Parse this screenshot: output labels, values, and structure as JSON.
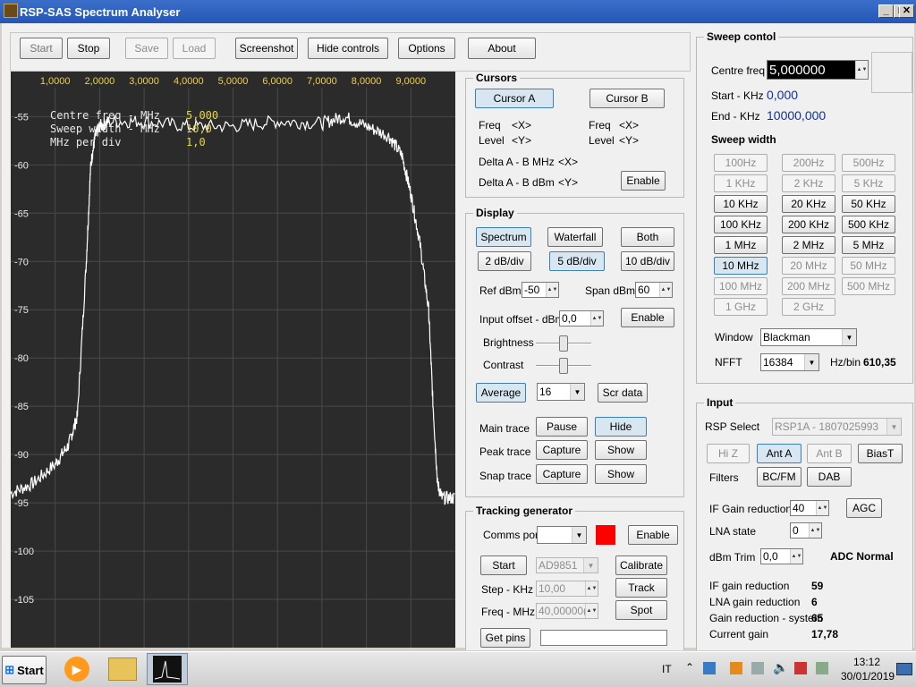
{
  "window": {
    "title": "RSP-SAS Spectrum Analyser"
  },
  "toolbar": {
    "start": "Start",
    "stop": "Stop",
    "save": "Save",
    "load": "Load",
    "screenshot": "Screenshot",
    "hide_controls": "Hide controls",
    "options": "Options",
    "about": "About"
  },
  "spectrum": {
    "x_ticks": [
      "1,0000",
      "2,0000",
      "3,0000",
      "4,0000",
      "5,0000",
      "6,0000",
      "7,0000",
      "8,0000",
      "9,0000"
    ],
    "y_ticks": [
      "-55",
      "-60",
      "-65",
      "-70",
      "-75",
      "-80",
      "-85",
      "-90",
      "-95",
      "-100",
      "-105"
    ],
    "overlay": {
      "centre_label": "Centre freq - MHz",
      "centre_value": "5,000",
      "sweep_label": "Sweep width - MHz",
      "sweep_value": "10,0",
      "perdiv_label": "MHz per div",
      "perdiv_value": "1,0"
    }
  },
  "chart_data": {
    "type": "line",
    "x_ticks": [
      "1,0000",
      "2,0000",
      "3,0000",
      "4,0000",
      "5,0000",
      "6,0000",
      "7,0000",
      "8,0000",
      "9,0000"
    ],
    "ylim": [
      -110,
      -52
    ],
    "xlim": [
      0,
      10
    ],
    "series": [
      {
        "x": [
          0,
          0.5,
          1,
          1.3,
          1.5,
          1.7,
          1.8,
          1.9,
          2.0,
          2.2,
          3,
          4,
          5,
          6,
          7,
          7.5,
          8,
          8.5,
          8.8,
          9.0,
          9.2,
          9.4,
          9.5,
          9.6,
          9.7,
          10
        ],
        "y": [
          -94,
          -93,
          -91,
          -89,
          -86,
          -70,
          -60,
          -57,
          -56,
          -55.5,
          -55.5,
          -56,
          -56,
          -55.5,
          -55.7,
          -55,
          -56,
          -57,
          -59,
          -63,
          -68,
          -75,
          -85,
          -93,
          -94.5,
          -94.5
        ]
      }
    ]
  },
  "cursors": {
    "title": "Cursors",
    "cursor_a": "Cursor A",
    "cursor_b": "Cursor B",
    "freq": "Freq",
    "level": "Level",
    "x": "<X>",
    "y": "<Y>",
    "delta_mhz": "Delta A - B MHz",
    "delta_dbm": "Delta A - B dBm",
    "enable": "Enable"
  },
  "display": {
    "title": "Display",
    "spectrum": "Spectrum",
    "waterfall": "Waterfall",
    "both": "Both",
    "db2": "2 dB/div",
    "db5": "5 dB/div",
    "db10": "10 dB/div",
    "ref_label": "Ref dBm",
    "ref_value": "-50",
    "span_label": "Span dBm",
    "span_value": "60",
    "offset_label": "Input offset - dBm",
    "offset_value": "0,0",
    "enable": "Enable",
    "brightness": "Brightness",
    "contrast": "Contrast",
    "average": "Average",
    "average_value": "16",
    "scr_data": "Scr data",
    "main_trace": "Main trace",
    "pause": "Pause",
    "hide": "Hide",
    "peak_trace": "Peak trace",
    "capture": "Capture",
    "show": "Show",
    "snap_trace": "Snap trace"
  },
  "tracking": {
    "title": "Tracking generator",
    "comms_label": "Comms port",
    "enable": "Enable",
    "start": "Start",
    "chip": "AD9851",
    "calibrate": "Calibrate",
    "step_label": "Step - KHz",
    "step_value": "10,00",
    "track": "Track",
    "freq_label": "Freq - MHz",
    "freq_value": "40,00000(",
    "spot": "Spot",
    "get_pins": "Get pins",
    "status_color": "#ff0000"
  },
  "sweep": {
    "title": "Sweep contol",
    "centre_label": "Centre freq",
    "centre_value": "5,000000",
    "start_label": "Start - KHz",
    "start_value": "0,000",
    "end_label": "End - KHz",
    "end_value": "10000,000",
    "width_title": "Sweep width",
    "widths": [
      "100Hz",
      "200Hz",
      "500Hz",
      "1 KHz",
      "2 KHz",
      "5 KHz",
      "10 KHz",
      "20 KHz",
      "50 KHz",
      "100 KHz",
      "200 KHz",
      "500 KHz",
      "1 MHz",
      "2 MHz",
      "5 MHz",
      "10 MHz",
      "20 MHz",
      "50 MHz",
      "100 MHz",
      "200 MHz",
      "500 MHz",
      "1 GHz",
      "2 GHz"
    ],
    "window_label": "Window",
    "window_value": "Blackman",
    "nfft_label": "NFFT",
    "nfft_value": "16384",
    "hzbin_label": "Hz/bin",
    "hzbin_value": "610,35"
  },
  "input": {
    "title": "Input",
    "rsp_label": "RSP Select",
    "rsp_value": "RSP1A - 1807025993",
    "hiz": "Hi Z",
    "ant_a": "Ant A",
    "ant_b": "Ant B",
    "biast": "BiasT",
    "filters": "Filters",
    "bcfm": "BC/FM",
    "dab": "DAB",
    "if_label": "IF Gain reduction",
    "if_value": "40",
    "agc": "AGC",
    "lna_label": "LNA state",
    "lna_value": "0",
    "trim_label": "dBm Trim",
    "trim_value": "0,0",
    "adc": "ADC Normal",
    "stats": [
      {
        "label": "IF gain reduction",
        "value": "59"
      },
      {
        "label": "LNA gain reduction",
        "value": "6"
      },
      {
        "label": "Gain reduction - system",
        "value": "65"
      },
      {
        "label": "Current gain",
        "value": "17,78"
      }
    ]
  },
  "taskbar": {
    "start": "Start",
    "lang": "IT",
    "time": "13:12",
    "date": "30/01/2019"
  }
}
